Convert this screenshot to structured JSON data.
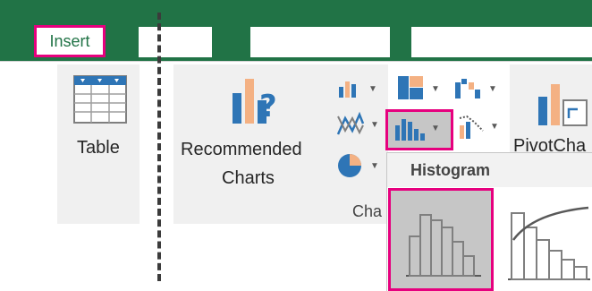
{
  "tabs": {
    "insert": "Insert"
  },
  "groups": {
    "tables": {
      "table_label": "Table"
    },
    "charts": {
      "recommended_line1": "Recommended",
      "recommended_line2": "Charts",
      "group_label_partial": "Cha",
      "pivotchart_partial": "PivotCha"
    }
  },
  "dropdown": {
    "header": "Histogram"
  },
  "colors": {
    "ribbon_green": "#217346",
    "highlight_pink": "#e6007e",
    "chart_blue": "#2e75b6",
    "chart_orange": "#f4b183"
  }
}
